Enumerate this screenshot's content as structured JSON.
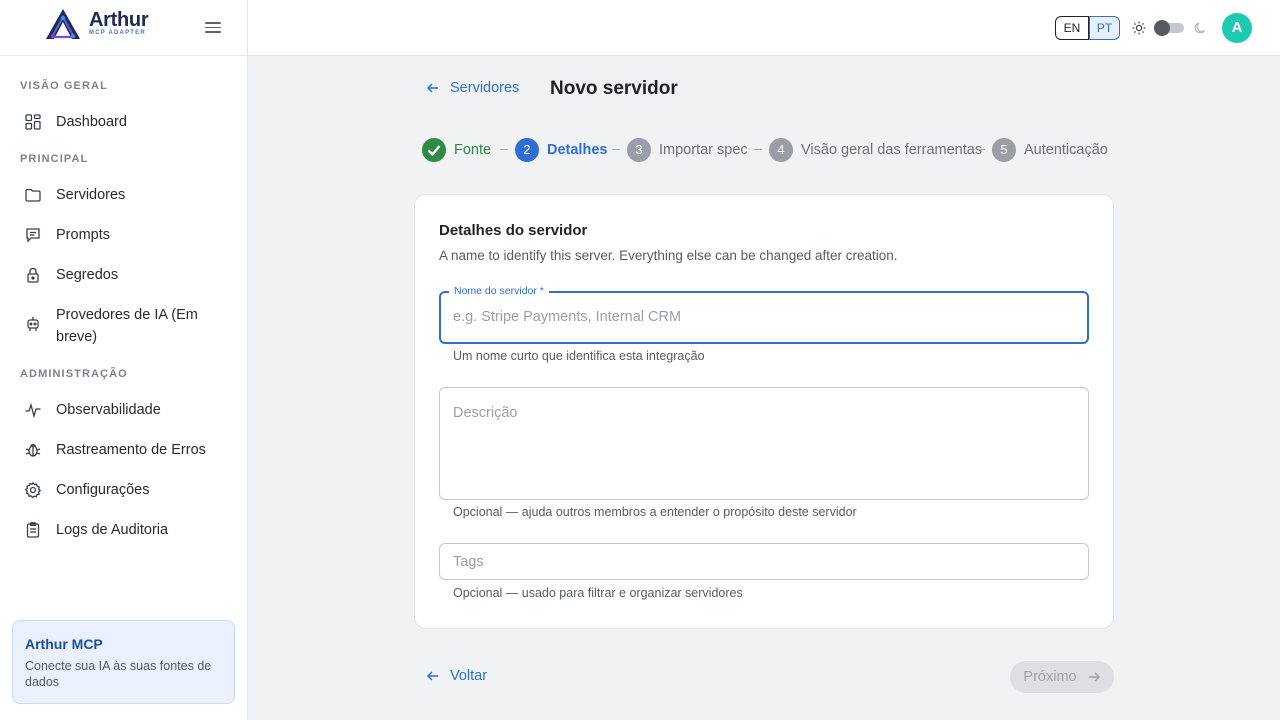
{
  "brand": {
    "name": "Arthur",
    "subtitle": "MCP ADAPTER"
  },
  "sidebar": {
    "sections": [
      {
        "title": "VISÃO GERAL"
      },
      {
        "title": "PRINCIPAL"
      },
      {
        "title": "ADMINISTRAÇÃO"
      }
    ],
    "items": [
      {
        "label": "Dashboard",
        "icon": "dashboard-icon"
      },
      {
        "label": "Servidores",
        "icon": "folder-icon"
      },
      {
        "label": "Prompts",
        "icon": "message-icon"
      },
      {
        "label": "Segredos",
        "icon": "lock-icon"
      },
      {
        "label": "Provedores de IA (Em breve)",
        "icon": "robot-icon"
      },
      {
        "label": "Observabilidade",
        "icon": "pulse-icon"
      },
      {
        "label": "Rastreamento de Erros",
        "icon": "bug-icon"
      },
      {
        "label": "Configurações",
        "icon": "gear-icon"
      },
      {
        "label": "Logs de Auditoria",
        "icon": "clipboard-icon"
      }
    ],
    "promo": {
      "title": "Arthur MCP",
      "text": "Conecte sua IA às suas fontes de dados"
    }
  },
  "topbar": {
    "languages": [
      "EN",
      "PT"
    ],
    "selected_language": "PT",
    "avatar_initial": "A"
  },
  "header": {
    "back_label": "Servidores",
    "title": "Novo servidor"
  },
  "stepper": {
    "steps": [
      {
        "number": "1",
        "label": "Fonte",
        "state": "done"
      },
      {
        "number": "2",
        "label": "Detalhes",
        "state": "active"
      },
      {
        "number": "3",
        "label": "Importar spec",
        "state": "todo"
      },
      {
        "number": "4",
        "label": "Visão geral das ferramentas",
        "state": "todo"
      },
      {
        "number": "5",
        "label": "Autenticação",
        "state": "todo"
      }
    ]
  },
  "form": {
    "title": "Detalhes do servidor",
    "subtitle": "A name to identify this server. Everything else can be changed after creation.",
    "name": {
      "label": "Nome do servidor *",
      "placeholder": "e.g. Stripe Payments, Internal CRM",
      "value": "",
      "helper": "Um nome curto que identifica esta integração"
    },
    "description": {
      "placeholder": "Descrição",
      "value": "",
      "helper": "Opcional — ajuda outros membros a entender o propósito deste servidor"
    },
    "tags": {
      "placeholder": "Tags",
      "value": "",
      "helper": "Opcional — usado para filtrar e organizar servidores"
    }
  },
  "footer": {
    "back_label": "Voltar",
    "next_label": "Próximo"
  },
  "colors": {
    "accent": "#2f6fd3",
    "success": "#2e8b45",
    "avatar": "#1ecbb0"
  }
}
